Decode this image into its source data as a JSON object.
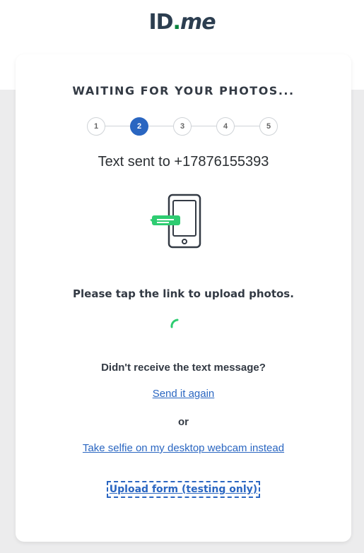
{
  "logo": {
    "id": "ID",
    "dot": ".",
    "me": "me"
  },
  "card": {
    "heading": "WAITING FOR YOUR PHOTOS...",
    "steps": [
      "1",
      "2",
      "3",
      "4",
      "5"
    ],
    "active_step": 2,
    "sent_text": "Text sent to +17876155393",
    "instruction": "Please tap the link to upload photos.",
    "no_text_question": "Didn't receive the text message?",
    "send_again_label": "Send it again",
    "or_label": "or",
    "webcam_label": "Take selfie on my desktop webcam instead",
    "upload_form_label": "Upload form (testing only)"
  },
  "colors": {
    "accent": "#2a66c1",
    "brand_green": "#08833d",
    "message_green": "#2ecc71",
    "text_dark": "#333a44"
  },
  "icons": {
    "phone": "phone-with-message-icon",
    "spinner": "loading-spinner-icon"
  }
}
